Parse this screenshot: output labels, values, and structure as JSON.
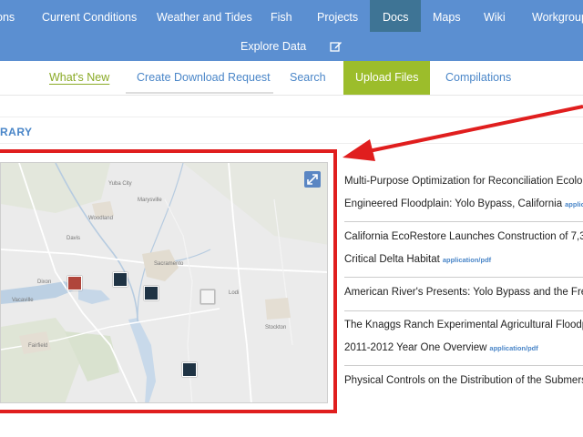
{
  "topnav": {
    "row1": [
      {
        "label": "ons"
      },
      {
        "label": "Current Conditions"
      },
      {
        "label": "Weather and Tides"
      },
      {
        "label": "Fish"
      },
      {
        "label": "Projects"
      },
      {
        "label": "Docs",
        "active": true
      },
      {
        "label": "Maps"
      },
      {
        "label": "Wiki"
      },
      {
        "label": "Workgroup"
      }
    ],
    "row2": [
      {
        "label": "Explore Data"
      }
    ],
    "edit_icon": "edit-square-icon"
  },
  "subnav": {
    "items": [
      {
        "label": "What's New"
      },
      {
        "label": "Create Download Request"
      },
      {
        "label": "Search"
      },
      {
        "label": "Upload Files"
      },
      {
        "label": "Compilations"
      }
    ]
  },
  "section": {
    "title": "RARY"
  },
  "map": {
    "expand_icon": "expand-arrows-icon",
    "labels": [
      "Yuba City",
      "Marysville",
      "Sacramento",
      "Woodland",
      "Davis",
      "Dixon",
      "Vacaville",
      "Fairfield",
      "Lodi",
      "Stockton"
    ],
    "markers": [
      {
        "icon": "pdf-thumbnail-icon",
        "kind": "red"
      },
      {
        "icon": "map-thumbnail-icon",
        "kind": "dark"
      },
      {
        "icon": "map-thumbnail-icon",
        "kind": "dark"
      },
      {
        "icon": "document-thumbnail-icon",
        "kind": "doc"
      },
      {
        "icon": "map-thumbnail-icon",
        "kind": "dark"
      }
    ]
  },
  "documents": [
    {
      "line1": "Multi-Purpose Optimization for Reconciliation Ecolo",
      "line2": "Engineered Floodplain: Yolo Bypass, California",
      "type": "applic"
    },
    {
      "line1": "California EcoRestore Launches Construction of 7,37",
      "line2": "Critical Delta Habitat",
      "type": "application/pdf"
    },
    {
      "line1": "American River's Presents: Yolo Bypass and the Fren",
      "line2": "",
      "type": ""
    },
    {
      "line1": "The Knaggs Ranch Experimental Agricultural Floodpl",
      "line2": "2011-2012 Year One Overview",
      "type": "application/pdf"
    },
    {
      "line1": "Physical Controls on the Distribution of the Submers",
      "line2": "",
      "type": ""
    }
  ],
  "colors": {
    "nav_bg": "#5b8fd1",
    "nav_active": "#3e7495",
    "accent_green": "#9cbd2b",
    "link_blue": "#4a86c8",
    "highlight_red": "#e01e1e"
  }
}
